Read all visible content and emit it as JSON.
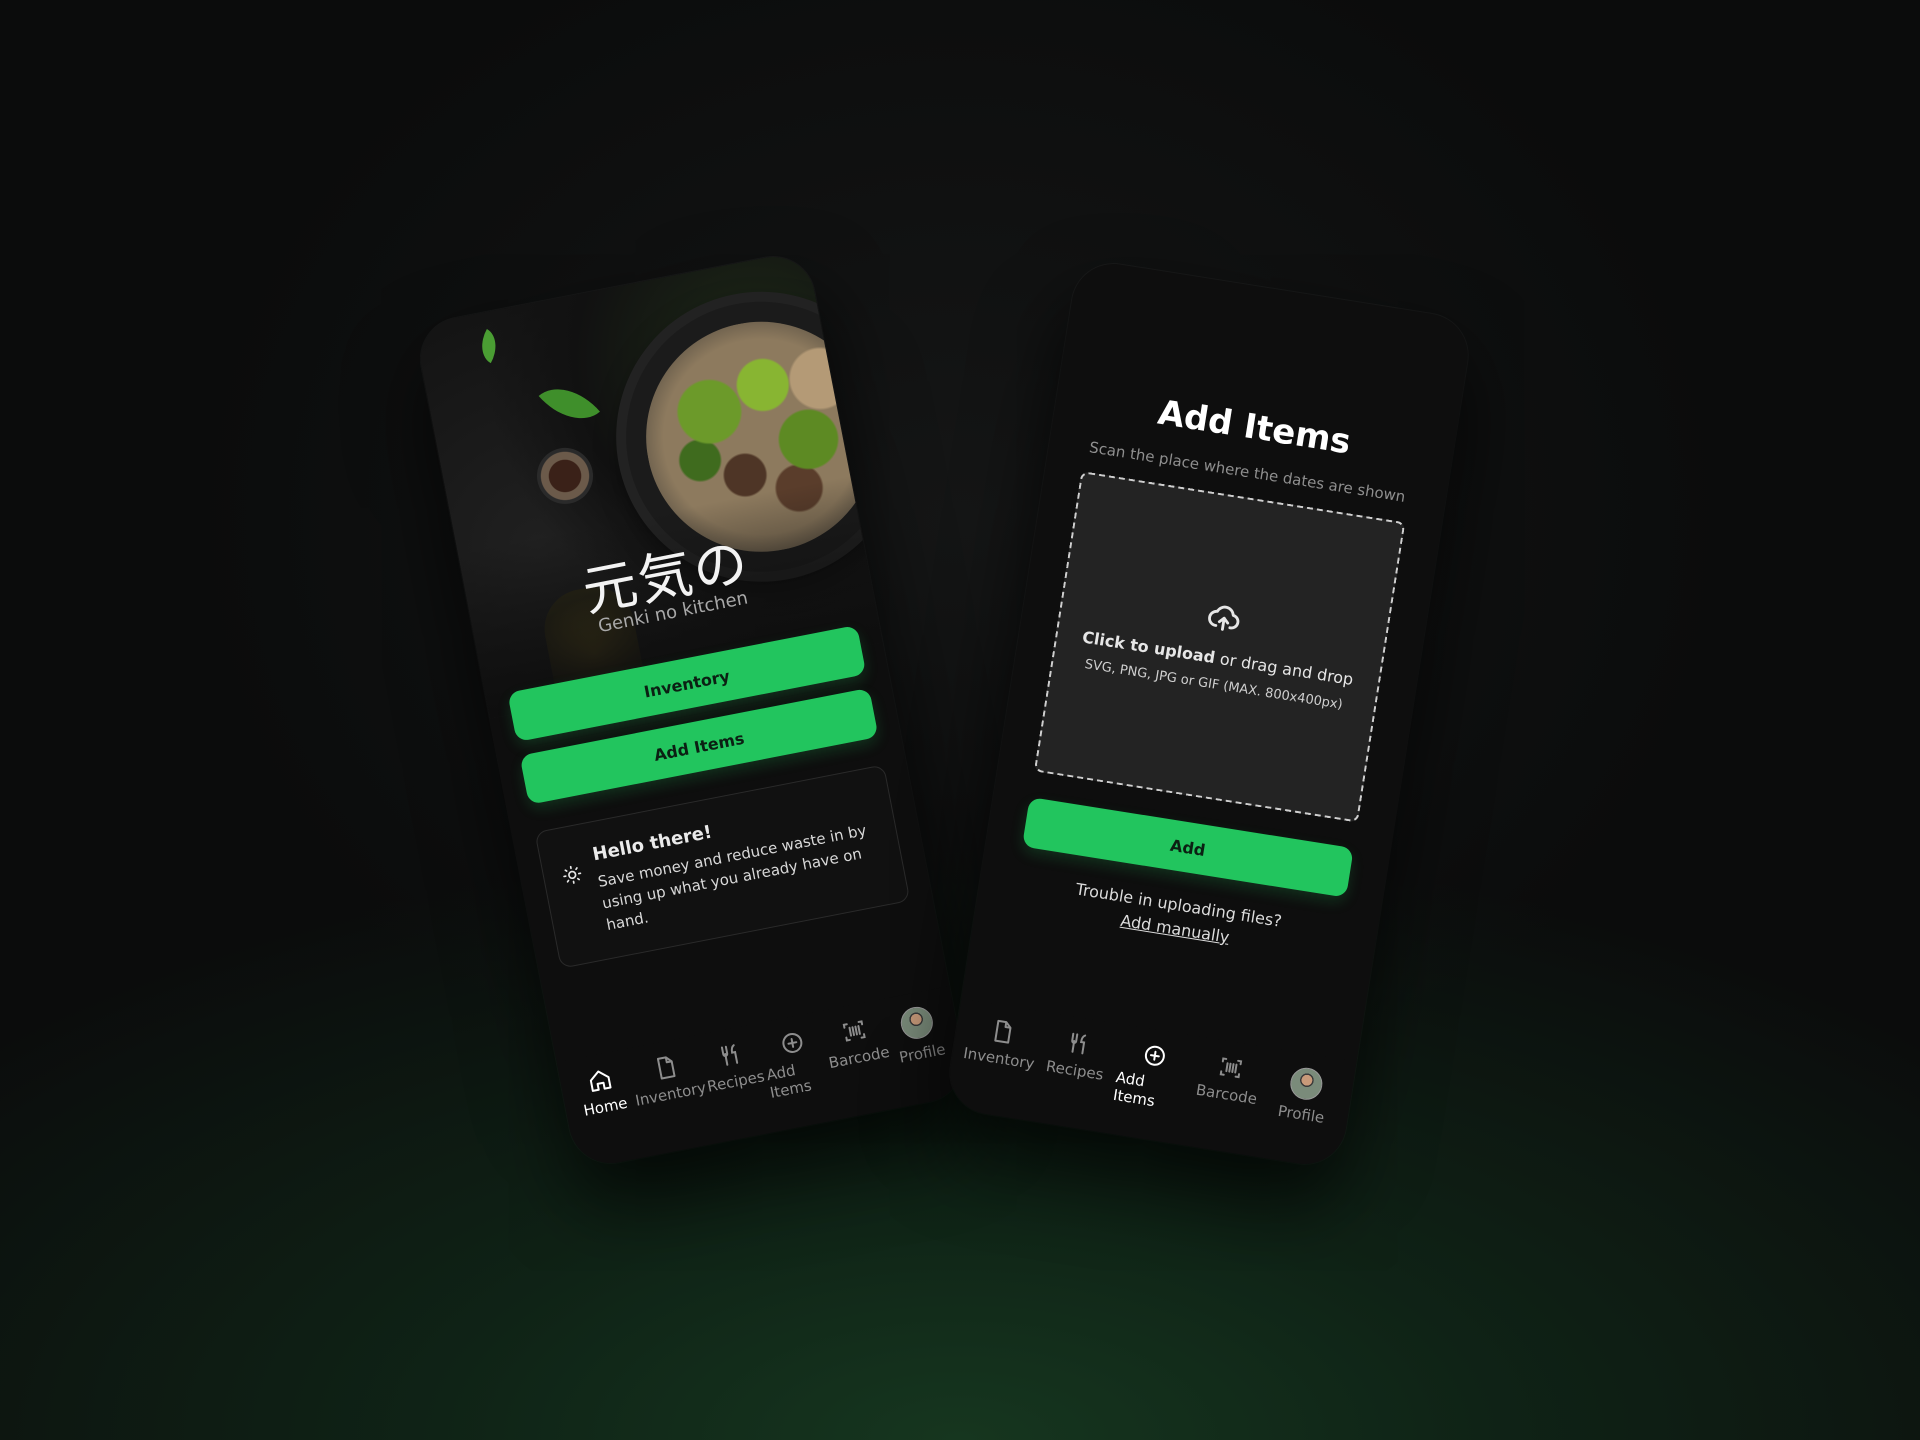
{
  "home": {
    "hero_title": "元気の",
    "hero_subtitle": "Genki no kitchen",
    "inventory_button": "Inventory",
    "add_items_button": "Add Items",
    "card_title": "Hello there!",
    "card_text": "Save money and reduce waste in by using up what you already have on hand."
  },
  "add_items": {
    "title": "Add Items",
    "subtitle": "Scan the place where the dates are shown",
    "upload_strong": "Click to upload",
    "upload_rest": "or drag and drop",
    "formats": "SVG, PNG, JPG or GIF (MAX. 800x400px)",
    "add_button": "Add",
    "trouble_text": "Trouble in uploading files?",
    "add_manually": "Add manually"
  },
  "tabs": [
    {
      "label": "Home",
      "icon": "home-icon"
    },
    {
      "label": "Inventory",
      "icon": "file-icon"
    },
    {
      "label": "Recipes",
      "icon": "utensils-icon"
    },
    {
      "label": "Add Items",
      "icon": "plus-circle-icon"
    },
    {
      "label": "Barcode",
      "icon": "barcode-scan-icon"
    },
    {
      "label": "Profile",
      "icon": "avatar"
    }
  ],
  "colors": {
    "accent": "#22c55e",
    "background": "#0b0c0c",
    "phone": "#0e0e0e"
  }
}
